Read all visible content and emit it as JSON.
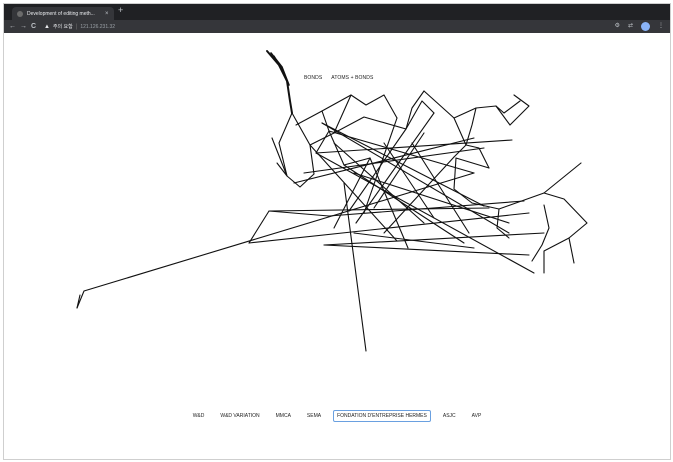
{
  "browser": {
    "tab_title": "Development of editing meth...",
    "tab_close": "×",
    "new_tab": "+",
    "back": "←",
    "forward": "→",
    "reload": "C",
    "warning": "▲",
    "security_text": "주의 요함",
    "url_separator": "|",
    "url": "121.126.231.32"
  },
  "page": {
    "view_options": [
      "BONDS",
      "ATOMS + BONDS"
    ],
    "nav_items": [
      "W&D",
      "W&D VARIATION",
      "MMCA",
      "SEMA",
      "FONDATION D'ENTREPRISE HERMES",
      "ASJC",
      "AVP"
    ],
    "active_nav": "FONDATION D'ENTREPRISE HERMES"
  }
}
